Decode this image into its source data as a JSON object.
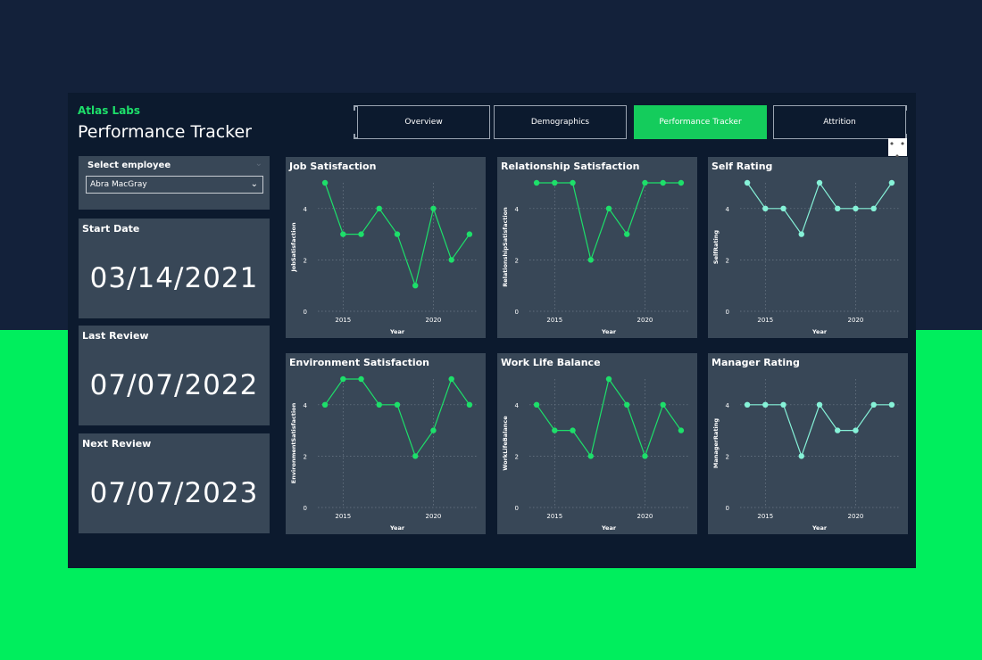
{
  "header": {
    "brand": "Atlas Labs",
    "title": "Performance Tracker"
  },
  "tabs": [
    {
      "label": "Overview",
      "active": false
    },
    {
      "label": "Demographics",
      "active": false
    },
    {
      "label": "Performance Tracker",
      "active": true
    },
    {
      "label": "Attrition",
      "active": false
    }
  ],
  "more_options": "• • •",
  "slicer": {
    "label": "Select employee",
    "value": "Abra MacGray"
  },
  "dates": {
    "start": {
      "label": "Start Date",
      "value": "03/14/2021"
    },
    "last": {
      "label": "Last Review",
      "value": "07/07/2022"
    },
    "next": {
      "label": "Next Review",
      "value": "07/07/2023"
    }
  },
  "colors": {
    "primary_line": "#1ddf6a",
    "secondary_line": "#86f2d8",
    "card_bg": "#384757",
    "accent": "#14cc5c"
  },
  "chart_data": [
    {
      "type": "line",
      "title": "Job Satisfaction",
      "xlabel": "Year",
      "ylabel": "JobSatisfaction",
      "x": [
        2014,
        2015,
        2016,
        2017,
        2018,
        2019,
        2020,
        2021,
        2022
      ],
      "values": [
        5,
        3,
        3,
        4,
        3,
        1,
        4,
        2,
        3
      ],
      "xticks": [
        "2015",
        "2020"
      ],
      "yticks": [
        "0",
        "2",
        "4"
      ],
      "ylim": [
        0,
        5
      ],
      "color": "#1ddf6a"
    },
    {
      "type": "line",
      "title": "Relationship Satisfaction",
      "xlabel": "Year",
      "ylabel": "RelationshipSatisfaction",
      "x": [
        2014,
        2015,
        2016,
        2017,
        2018,
        2019,
        2020,
        2021,
        2022
      ],
      "values": [
        5,
        5,
        5,
        2,
        4,
        3,
        5,
        5,
        5
      ],
      "xticks": [
        "2015",
        "2020"
      ],
      "yticks": [
        "0",
        "2",
        "4"
      ],
      "ylim": [
        0,
        5
      ],
      "color": "#1ddf6a"
    },
    {
      "type": "line",
      "title": "Self Rating",
      "xlabel": "Year",
      "ylabel": "SelfRating",
      "x": [
        2014,
        2015,
        2016,
        2017,
        2018,
        2019,
        2020,
        2021,
        2022
      ],
      "values": [
        5,
        4,
        4,
        3,
        5,
        4,
        4,
        4,
        5
      ],
      "xticks": [
        "2015",
        "2020"
      ],
      "yticks": [
        "0",
        "2",
        "4"
      ],
      "ylim": [
        0,
        5
      ],
      "color": "#86f2d8"
    },
    {
      "type": "line",
      "title": "Environment Satisfaction",
      "xlabel": "Year",
      "ylabel": "EnvironmentSatisfaction",
      "x": [
        2014,
        2015,
        2016,
        2017,
        2018,
        2019,
        2020,
        2021,
        2022
      ],
      "values": [
        4,
        5,
        5,
        4,
        4,
        2,
        3,
        5,
        4
      ],
      "xticks": [
        "2015",
        "2020"
      ],
      "yticks": [
        "0",
        "2",
        "4"
      ],
      "ylim": [
        0,
        5
      ],
      "color": "#1ddf6a"
    },
    {
      "type": "line",
      "title": "Work Life Balance",
      "xlabel": "Year",
      "ylabel": "WorkLifeBalance",
      "x": [
        2014,
        2015,
        2016,
        2017,
        2018,
        2019,
        2020,
        2021,
        2022
      ],
      "values": [
        4,
        3,
        3,
        2,
        5,
        4,
        2,
        4,
        3
      ],
      "xticks": [
        "2015",
        "2020"
      ],
      "yticks": [
        "0",
        "2",
        "4"
      ],
      "ylim": [
        0,
        5
      ],
      "color": "#1ddf6a"
    },
    {
      "type": "line",
      "title": "Manager Rating",
      "xlabel": "Year",
      "ylabel": "ManagerRating",
      "x": [
        2014,
        2015,
        2016,
        2017,
        2018,
        2019,
        2020,
        2021,
        2022
      ],
      "values": [
        4,
        4,
        4,
        2,
        4,
        3,
        3,
        4,
        4
      ],
      "xticks": [
        "2015",
        "2020"
      ],
      "yticks": [
        "0",
        "2",
        "4"
      ],
      "ylim": [
        0,
        5
      ],
      "color": "#86f2d8"
    }
  ]
}
